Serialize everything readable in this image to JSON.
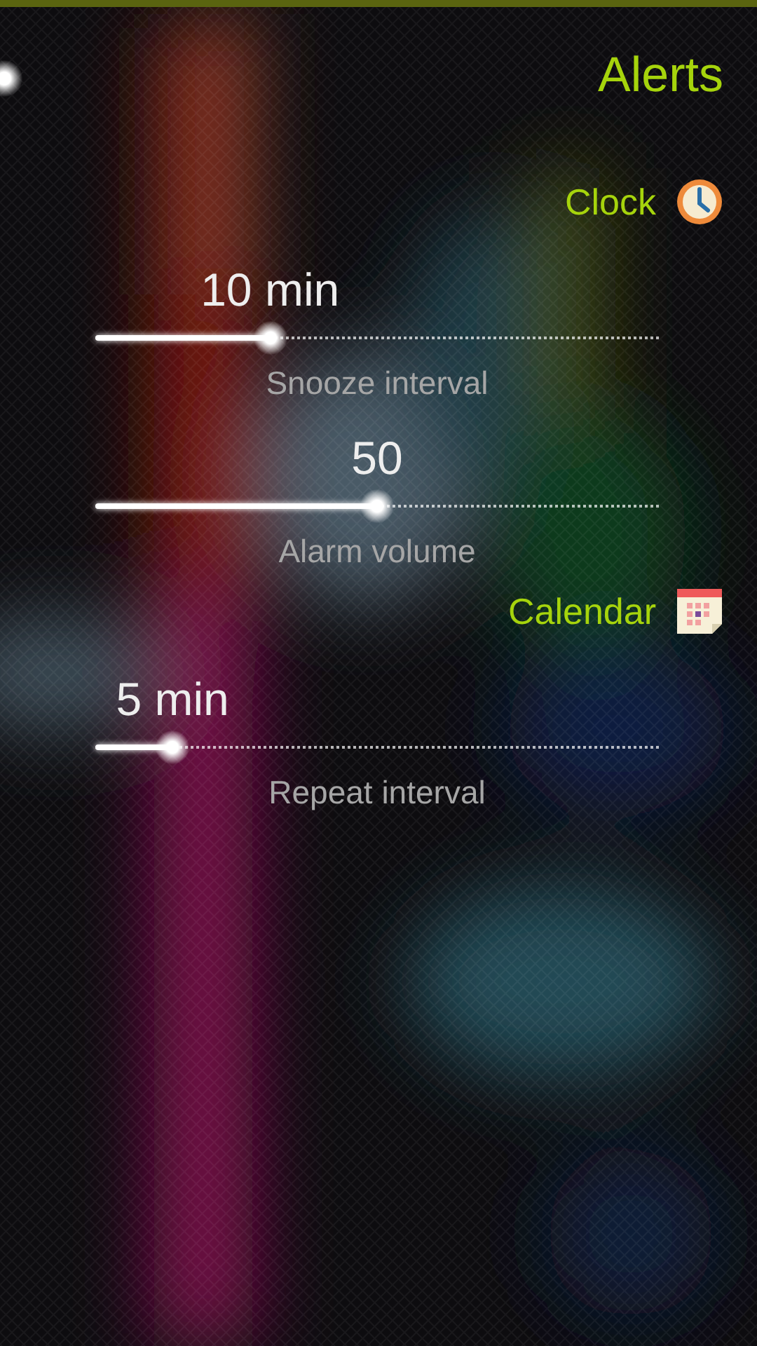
{
  "page": {
    "title": "Alerts"
  },
  "items": [
    {
      "kind": "header",
      "label": "Clock"
    },
    {
      "kind": "slider",
      "value": "10 min",
      "level": 0.31,
      "label": "Snooze interval"
    },
    {
      "kind": "slider",
      "value": "50",
      "level": 0.5,
      "label": "Alarm volume"
    },
    {
      "kind": "header",
      "label": "Calendar"
    },
    {
      "kind": "slider",
      "value": "5 min",
      "level": 0.137,
      "label": "Repeat interval"
    }
  ]
}
